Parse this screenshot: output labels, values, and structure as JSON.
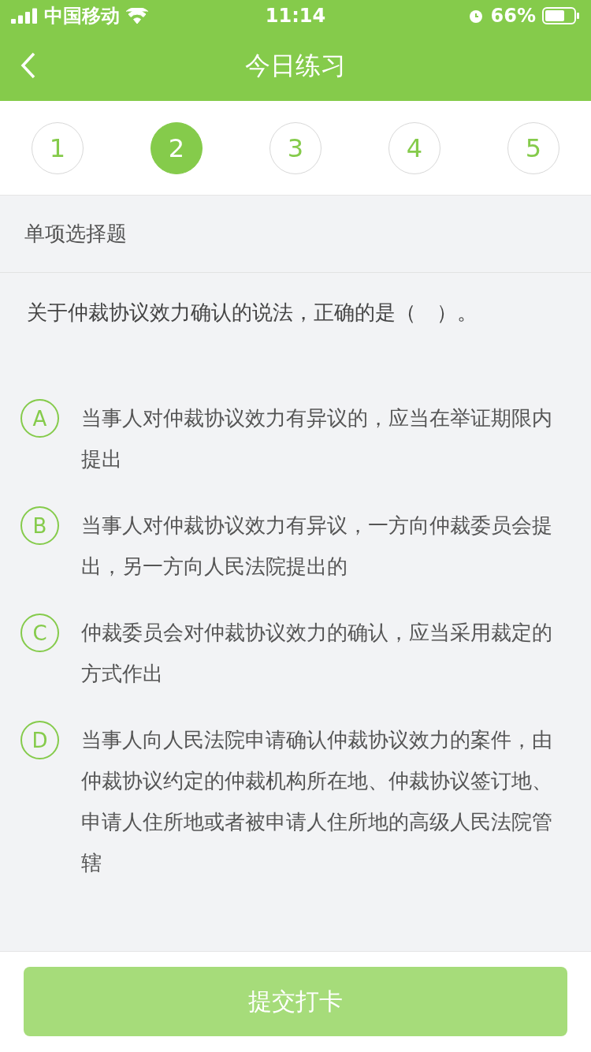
{
  "status_bar": {
    "carrier": "中国移动",
    "time": "11:14",
    "battery": "66%"
  },
  "header": {
    "title": "今日练习"
  },
  "steps": [
    {
      "label": "1",
      "selected": false
    },
    {
      "label": "2",
      "selected": true
    },
    {
      "label": "3",
      "selected": false
    },
    {
      "label": "4",
      "selected": false
    },
    {
      "label": "5",
      "selected": false
    }
  ],
  "question_type": "单项选择题",
  "question": "关于仲裁协议效力确认的说法，正确的是（　）。",
  "options": [
    {
      "letter": "A",
      "text": "当事人对仲裁协议效力有异议的，应当在举证期限内提出"
    },
    {
      "letter": "B",
      "text": "当事人对仲裁协议效力有异议，一方向仲裁委员会提出，另一方向人民法院提出的"
    },
    {
      "letter": "C",
      "text": "仲裁委员会对仲裁协议效力的确认，应当采用裁定的方式作出"
    },
    {
      "letter": "D",
      "text": "当事人向人民法院申请确认仲裁协议效力的案件，由仲裁协议约定的仲裁机构所在地、仲裁协议签订地、申请人住所地或者被申请人住所地的高级人民法院管辖"
    }
  ],
  "submit_button": {
    "label": "提交打卡",
    "disabled": true
  }
}
